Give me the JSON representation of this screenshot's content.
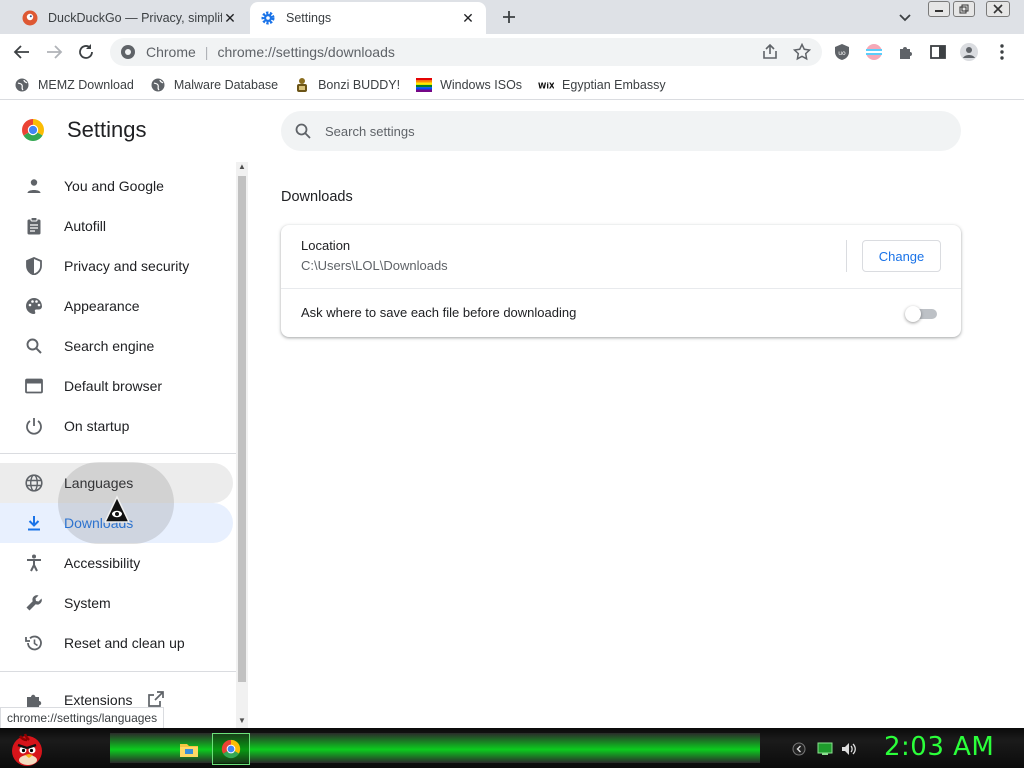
{
  "tabs": [
    {
      "label": "DuckDuckGo — Privacy, simplified.",
      "icon": "duckduckgo-icon",
      "active": false
    },
    {
      "label": "Settings",
      "icon": "settings-gear-icon",
      "active": true
    }
  ],
  "omnibox": {
    "chip": "Chrome",
    "url": "chrome://settings/downloads"
  },
  "bookmarks": [
    {
      "label": "MEMZ Download",
      "icon": "globe-icon"
    },
    {
      "label": "Malware Database",
      "icon": "globe-icon"
    },
    {
      "label": "Bonzi BUDDY!",
      "icon": "bonzi-icon"
    },
    {
      "label": "Windows ISOs",
      "icon": "rainbow-flag-icon"
    },
    {
      "label": "Egyptian Embassy",
      "icon": "wix-icon"
    }
  ],
  "settings": {
    "title": "Settings",
    "search_placeholder": "Search settings"
  },
  "sidebar": {
    "items": [
      {
        "label": "You and Google",
        "icon": "person-icon"
      },
      {
        "label": "Autofill",
        "icon": "clipboard-icon"
      },
      {
        "label": "Privacy and security",
        "icon": "shield-icon"
      },
      {
        "label": "Appearance",
        "icon": "palette-icon"
      },
      {
        "label": "Search engine",
        "icon": "search-icon"
      },
      {
        "label": "Default browser",
        "icon": "browser-window-icon"
      },
      {
        "label": "On startup",
        "icon": "power-icon"
      },
      {
        "label": "Languages",
        "icon": "globe-icon"
      },
      {
        "label": "Downloads",
        "icon": "download-icon"
      },
      {
        "label": "Accessibility",
        "icon": "accessibility-icon"
      },
      {
        "label": "System",
        "icon": "wrench-icon"
      },
      {
        "label": "Reset and clean up",
        "icon": "history-icon"
      },
      {
        "label": "Extensions",
        "icon": "puzzle-icon"
      }
    ],
    "selected": "Downloads",
    "hovered": "Languages"
  },
  "downloads": {
    "section_title": "Downloads",
    "location_label": "Location",
    "location_path": "C:\\Users\\LOL\\Downloads",
    "change_label": "Change",
    "ask_label": "Ask where to save each file before downloading",
    "ask_enabled": false
  },
  "status_bar": {
    "text": "chrome://settings/languages"
  },
  "taskbar": {
    "clock": "2:03 AM"
  },
  "colors": {
    "accent": "#1a73e8",
    "selected_bg": "#e8f0fe",
    "clock": "#2bff3a",
    "taskbar_glow": "#0ccc1e"
  }
}
